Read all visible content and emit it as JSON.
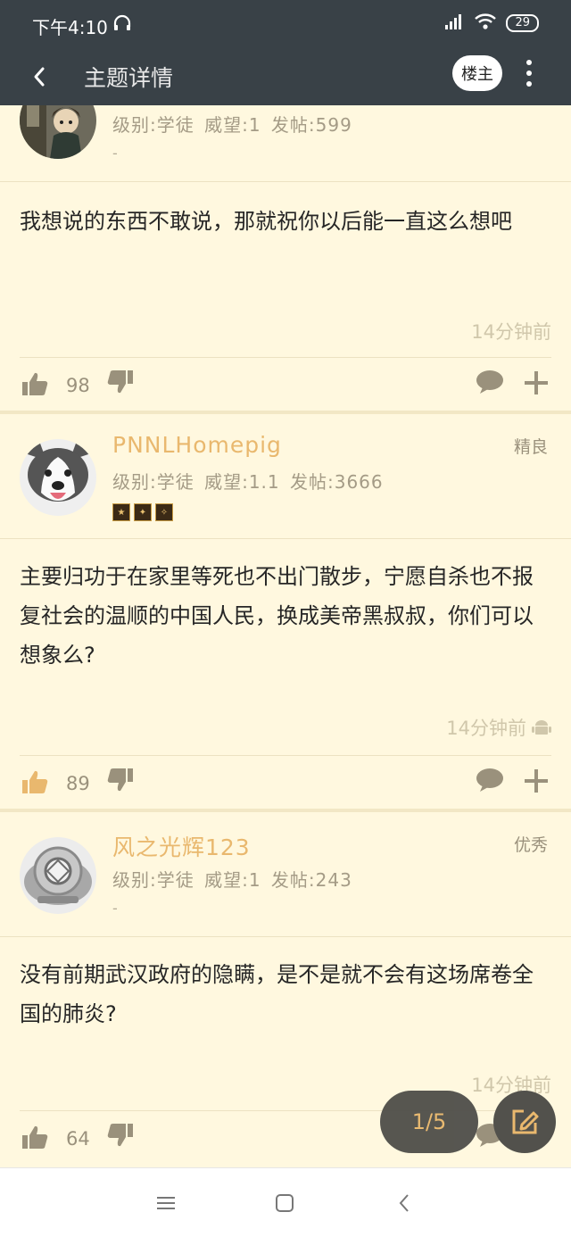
{
  "status_bar": {
    "time": "下午4:10",
    "battery": "29"
  },
  "app_bar": {
    "title": "主题详情",
    "owner_label": "楼主"
  },
  "posts": [
    {
      "username": "",
      "stats": "级别:学徒   威望:1   发帖:599",
      "signature": "-",
      "grade": "",
      "body": "我想说的东西不敢说，那就祝你以后能一直这么想吧",
      "time": "14分钟前",
      "likes": "98",
      "liked": false
    },
    {
      "username": "PNNLHomepig",
      "stats": "级别:学徒   威望:1.1   发帖:3666",
      "signature": "",
      "grade": "精良",
      "body": "主要归功于在家里等死也不出门散步，宁愿自杀也不报复社会的温顺的中国人民，换成美帝黑叔叔，你们可以想象么?",
      "time": "14分钟前",
      "likes": "89",
      "liked": true
    },
    {
      "username": "风之光辉123",
      "stats": "级别:学徒   威望:1   发帖:243",
      "signature": "-",
      "grade": "优秀",
      "body": "没有前期武汉政府的隐瞒，是不是就不会有这场席卷全国的肺炎?",
      "time": "14分钟前",
      "likes": "64",
      "liked": false
    }
  ],
  "pagination": {
    "label": "1/5"
  },
  "colors": {
    "accent": "#e9b86e",
    "background": "#fff8df",
    "toolbar": "#394147"
  },
  "icons": [
    "back-icon",
    "more-icon",
    "thumbs-up-icon",
    "thumbs-down-icon",
    "comment-icon",
    "plus-icon",
    "android-icon",
    "edit-icon",
    "menu-icon",
    "home-icon",
    "nav-back-icon",
    "headset-icon",
    "signal-icon",
    "wifi-icon"
  ]
}
